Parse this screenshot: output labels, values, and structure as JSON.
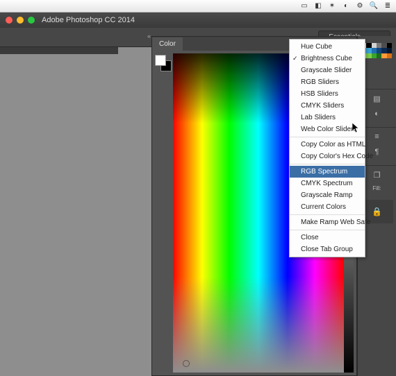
{
  "app": {
    "title": "Adobe Photoshop CC 2014"
  },
  "workspace": {
    "label": "Essentials"
  },
  "color_panel": {
    "tab": "Color",
    "foreground": "#ffffff",
    "background": "#000000"
  },
  "context_menu": {
    "groups": [
      {
        "items": [
          {
            "label": "Hue Cube",
            "checked": false
          },
          {
            "label": "Brightness Cube",
            "checked": true
          },
          {
            "label": "Grayscale Slider",
            "checked": false
          },
          {
            "label": "RGB Sliders",
            "checked": false
          },
          {
            "label": "HSB Sliders",
            "checked": false
          },
          {
            "label": "CMYK Sliders",
            "checked": false
          },
          {
            "label": "Lab Sliders",
            "checked": false
          },
          {
            "label": "Web Color Sliders",
            "checked": false
          }
        ]
      },
      {
        "items": [
          {
            "label": "Copy Color as HTML",
            "checked": false
          },
          {
            "label": "Copy Color's Hex Code",
            "checked": false
          }
        ]
      },
      {
        "items": [
          {
            "label": "RGB Spectrum",
            "checked": false,
            "highlighted": true
          },
          {
            "label": "CMYK Spectrum",
            "checked": false
          },
          {
            "label": "Grayscale Ramp",
            "checked": false
          },
          {
            "label": "Current Colors",
            "checked": false
          }
        ]
      },
      {
        "items": [
          {
            "label": "Make Ramp Web Safe",
            "checked": false
          }
        ]
      },
      {
        "items": [
          {
            "label": "Close",
            "checked": false
          },
          {
            "label": "Close Tab Group",
            "checked": false
          }
        ]
      }
    ]
  },
  "swatches": [
    "#ffffff",
    "#000000",
    "#d3d3d3",
    "#7a7a7a",
    "#4d4d4d",
    "#000000",
    "#6fc2e0",
    "#3aa3d6",
    "#1f6fae",
    "#12447a",
    "#0b2a4f",
    "#05182f",
    "#c3e89a",
    "#7ccf4a",
    "#3aa42c",
    "#1f6b1c",
    "#ff9a3a",
    "#d97012"
  ],
  "dock": {
    "fill_label": "Fill:"
  },
  "mac_icons": [
    "display-icon",
    "bt-icon",
    "wifi-icon",
    "battery-icon",
    "gear-icon",
    "search-icon",
    "menu-icon"
  ]
}
